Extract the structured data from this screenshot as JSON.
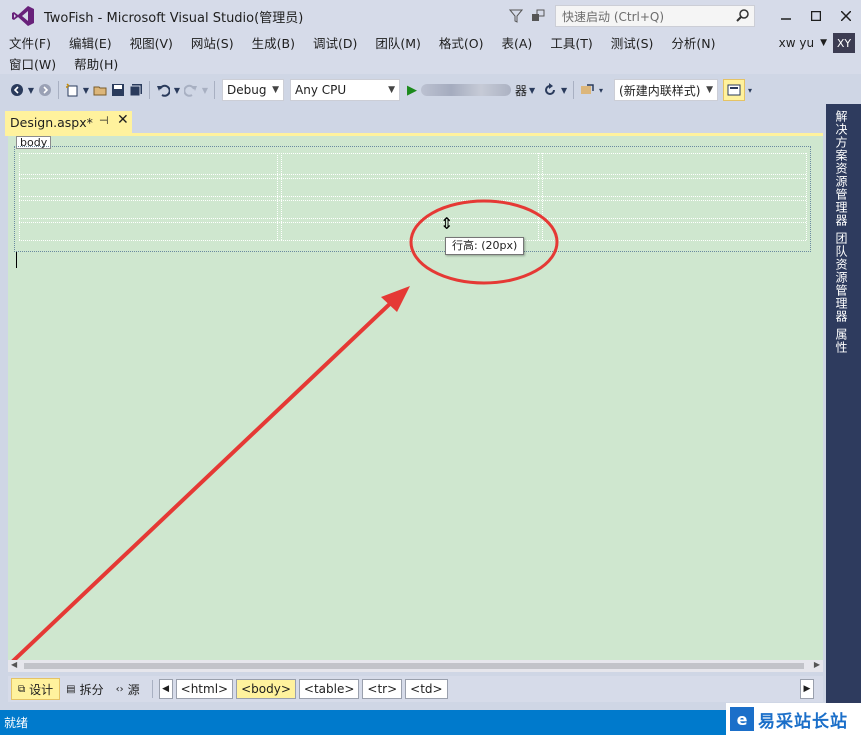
{
  "window": {
    "title": "TwoFish - Microsoft Visual Studio(管理员)",
    "quick_launch_placeholder": "快速启动 (Ctrl+Q)",
    "user_name": "xw yu",
    "user_initials": "XY"
  },
  "menu": {
    "row1": [
      "文件(F)",
      "编辑(E)",
      "视图(V)",
      "网站(S)",
      "生成(B)",
      "调试(D)",
      "团队(M)",
      "格式(O)",
      "表(A)",
      "工具(T)",
      "测试(S)",
      "分析(N)"
    ],
    "row2": [
      "窗口(W)",
      "帮助(H)"
    ]
  },
  "toolbar": {
    "config": "Debug",
    "platform": "Any CPU",
    "run_suffix": "器",
    "style_mode": "(新建内联样式)"
  },
  "tab": {
    "label": "Design.aspx*"
  },
  "side_panels": [
    "解决方案资源管理器",
    "团队资源管理器",
    "属性"
  ],
  "designer": {
    "body_tag": "body",
    "tooltip": "行高: (20px)"
  },
  "viewbar": {
    "design": "设计",
    "split": "拆分",
    "source": "源",
    "crumbs": [
      "<html>",
      "<body>",
      "<table>",
      "<tr>",
      "<td>"
    ]
  },
  "status": {
    "text": "就绪"
  },
  "watermark": {
    "text": "易采站长站"
  },
  "colors": {
    "accent": "#007acc",
    "tab_active": "#fff29d",
    "design_bg": "#cfe7cf",
    "annotation_red": "#e53935"
  }
}
